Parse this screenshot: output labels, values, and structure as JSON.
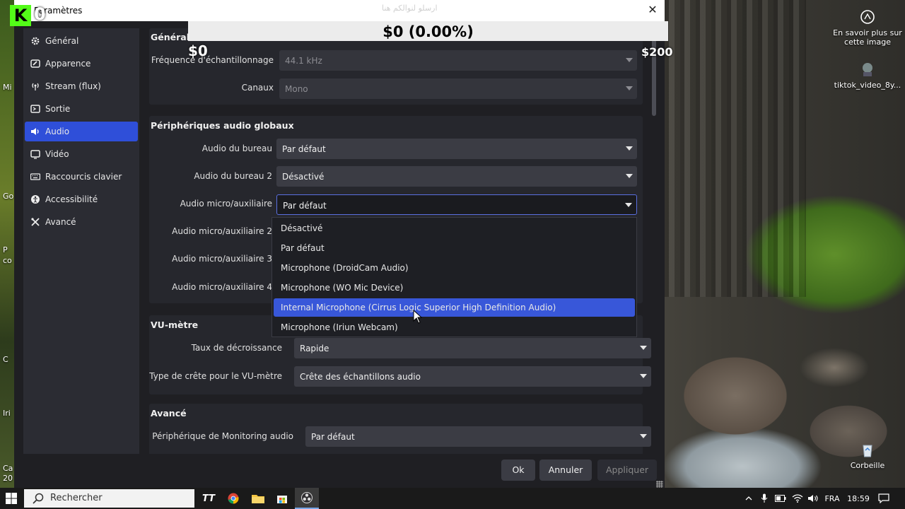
{
  "window": {
    "title": "Paramètres",
    "close_icon": "close-icon"
  },
  "overlay": {
    "logo_letter": "K",
    "logo_digit": "0",
    "goal_text": "$0 (0.00%)",
    "left_amount": "$0",
    "right_amount": "$200",
    "arabic_text": "ارسلو لنوالكم هنا"
  },
  "sidebar": {
    "items": [
      {
        "label": "Général",
        "icon": "gear-icon"
      },
      {
        "label": "Apparence",
        "icon": "palette-icon"
      },
      {
        "label": "Stream (flux)",
        "icon": "broadcast-icon"
      },
      {
        "label": "Sortie",
        "icon": "output-icon"
      },
      {
        "label": "Audio",
        "icon": "speaker-icon",
        "active": true
      },
      {
        "label": "Vidéo",
        "icon": "monitor-icon"
      },
      {
        "label": "Raccourcis clavier",
        "icon": "keyboard-icon"
      },
      {
        "label": "Accessibilité",
        "icon": "accessibility-icon"
      },
      {
        "label": "Avancé",
        "icon": "tools-icon"
      }
    ]
  },
  "general": {
    "title": "Général",
    "sample_rate_label": "Fréquence d'échantillonnage",
    "sample_rate_value": "44.1 kHz",
    "channels_label": "Canaux",
    "channels_value": "Mono"
  },
  "global_audio": {
    "title": "Périphériques audio globaux",
    "desktop_label": "Audio du bureau",
    "desktop_value": "Par défaut",
    "desktop2_label": "Audio du bureau 2",
    "desktop2_value": "Désactivé",
    "mic_label": "Audio micro/auxiliaire",
    "mic_value": "Par défaut",
    "mic2_label": "Audio micro/auxiliaire 2",
    "mic3_label": "Audio micro/auxiliaire 3",
    "mic4_label": "Audio micro/auxiliaire 4"
  },
  "dropdown": {
    "options": [
      "Désactivé",
      "Par défaut",
      "Microphone (DroidCam Audio)",
      "Microphone (WO Mic Device)",
      "Internal Microphone (Cirrus Logic Superior High Definition Audio)",
      "Microphone (Iriun Webcam)"
    ],
    "highlighted": "Internal Microphone (Cirrus Logic Superior High Definition Audio)"
  },
  "vu": {
    "title": "VU-mètre",
    "decay_label": "Taux de décroissance",
    "decay_value": "Rapide",
    "peak_label": "Type de crête pour le VU-mètre",
    "peak_value": "Crête des échantillons audio"
  },
  "advanced": {
    "title": "Avancé",
    "monitor_label": "Périphérique de Monitoring audio",
    "monitor_value": "Par défaut"
  },
  "buttons": {
    "ok": "Ok",
    "cancel": "Annuler",
    "apply": "Appliquer"
  },
  "desktop": {
    "learn_more": "En savoir plus sur cette image",
    "tiktok_file": "tiktok_video_8y...",
    "recycle_bin": "Corbeille",
    "left_edge_labels": [
      "Mi",
      "Go",
      "P",
      "co",
      "C",
      "Iri",
      "Ca",
      "20"
    ]
  },
  "taskbar": {
    "search_placeholder": "Rechercher",
    "language": "FRA",
    "time": "18:59",
    "apps": [
      "tiktok-icon",
      "chrome-icon",
      "file-explorer-icon",
      "store-icon",
      "obs-icon"
    ]
  },
  "colors": {
    "accent": "#2f4fd9",
    "highlight": "#3857d9",
    "window_bg": "#1f1f23"
  }
}
